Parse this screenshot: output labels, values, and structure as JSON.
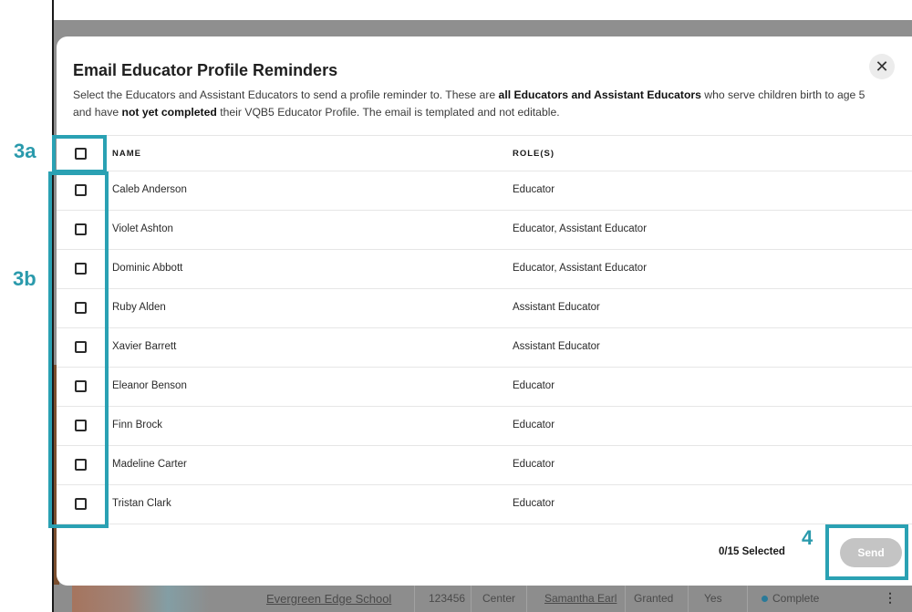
{
  "background": {
    "row": {
      "school": "Evergreen Edge School",
      "id": "123456",
      "type": "Center",
      "person": "Samantha Earl",
      "access": "Granted",
      "flag": "Yes",
      "status": "Complete"
    }
  },
  "modal": {
    "title": "Email Educator Profile Reminders",
    "desc": {
      "p1": "Select the Educators and Assistant Educators to send a profile reminder to. These are ",
      "b1": "all Educators and Assistant Educators",
      "p2": " who serve children birth to age 5 and have ",
      "b2": "not yet completed",
      "p3": " their VQB5 Educator Profile. The email is templated and not editable."
    },
    "close_icon": "close-icon",
    "table": {
      "headers": {
        "name": "NAME",
        "role": "ROLE(S)"
      },
      "rows": [
        {
          "name": "Caleb Anderson",
          "role": "Educator"
        },
        {
          "name": "Violet Ashton",
          "role": "Educator, Assistant Educator"
        },
        {
          "name": "Dominic Abbott",
          "role": "Educator, Assistant Educator"
        },
        {
          "name": "Ruby Alden",
          "role": "Assistant Educator"
        },
        {
          "name": "Xavier Barrett",
          "role": "Assistant Educator"
        },
        {
          "name": "Eleanor Benson",
          "role": "Educator"
        },
        {
          "name": "Finn Brock",
          "role": "Educator"
        },
        {
          "name": "Madeline Carter",
          "role": "Educator"
        },
        {
          "name": "Tristan Clark",
          "role": "Educator"
        }
      ]
    },
    "footer": {
      "selected_count": "0/15 Selected",
      "send_label": "Send"
    }
  },
  "annotations": {
    "a3a": "3a",
    "a3b": "3b",
    "a4": "4",
    "color": "#2aa1b3"
  }
}
